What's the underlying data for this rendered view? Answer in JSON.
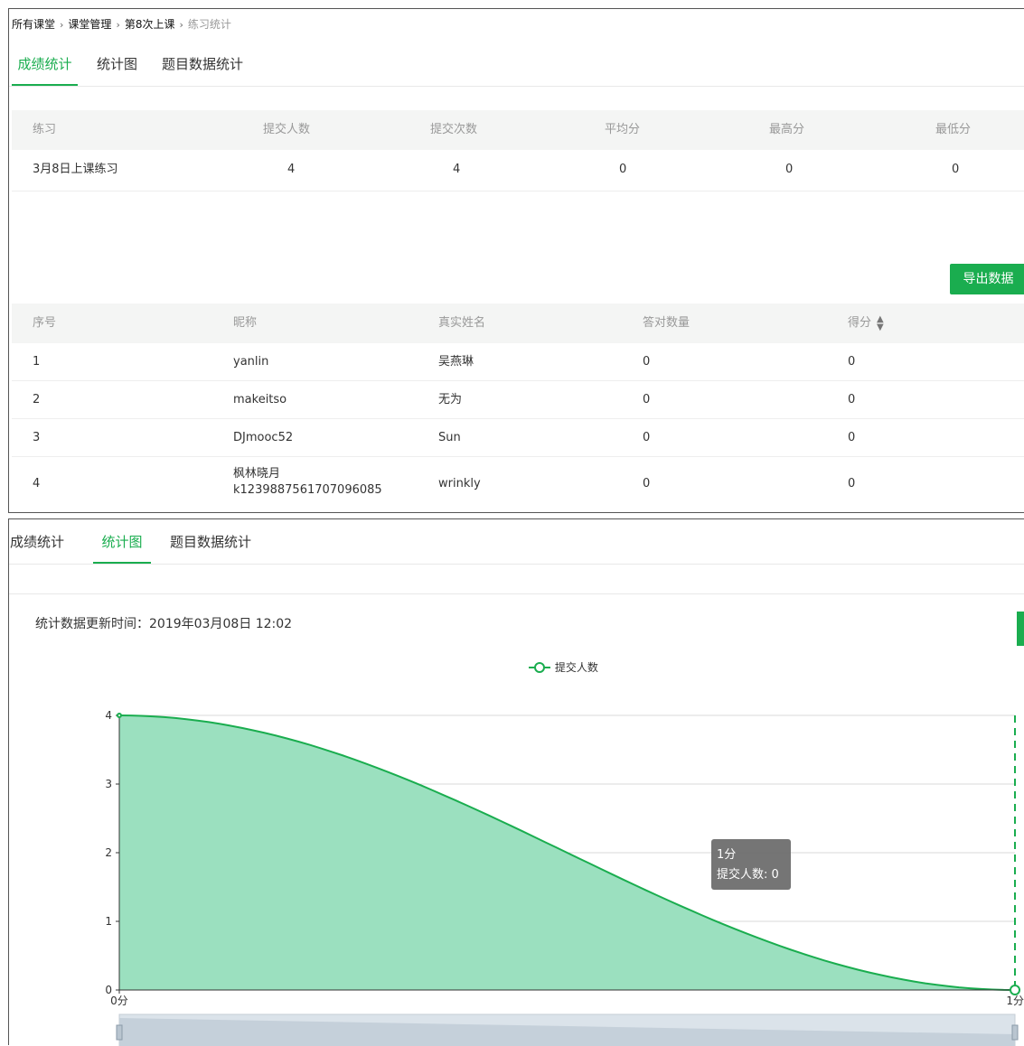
{
  "breadcrumb": {
    "items": [
      "所有课堂",
      "课堂管理",
      "第8次上课"
    ],
    "current": "练习统计",
    "separator": "›"
  },
  "tabs": [
    "成绩统计",
    "统计图",
    "题目数据统计"
  ],
  "summary_table": {
    "headers": [
      "练习",
      "提交人数",
      "提交次数",
      "平均分",
      "最高分",
      "最低分"
    ],
    "rows": [
      [
        "3月8日上课练习",
        "4",
        "4",
        "0",
        "0",
        "0"
      ]
    ]
  },
  "export_button": "导出数据",
  "students_table": {
    "headers": [
      "序号",
      "昵称",
      "真实姓名",
      "答对数量",
      "得分"
    ],
    "rows": [
      {
        "index": "1",
        "nickname": "yanlin",
        "nickname2": "",
        "real_name": "吴燕琳",
        "correct": "0",
        "score": "0"
      },
      {
        "index": "2",
        "nickname": "makeitso",
        "nickname2": "",
        "real_name": "无为",
        "correct": "0",
        "score": "0"
      },
      {
        "index": "3",
        "nickname": "DJmooc52",
        "nickname2": "",
        "real_name": "Sun",
        "correct": "0",
        "score": "0"
      },
      {
        "index": "4",
        "nickname": "枫林晓月",
        "nickname2": "k1239887561707096085",
        "real_name": "wrinkly",
        "correct": "0",
        "score": "0"
      }
    ]
  },
  "update_time": "统计数据更新时间：2019年03月08日 12:02",
  "colors": {
    "accent": "#1aad4f",
    "area_fill": "#9be0bf",
    "tooltip_bg": "#6e6e6e"
  },
  "chart_data": {
    "type": "area",
    "x": [
      "0分",
      "1分"
    ],
    "series": [
      {
        "name": "提交人数",
        "values": [
          4,
          0
        ]
      }
    ],
    "ylim": [
      0,
      4
    ],
    "yticks": [
      "0",
      "1",
      "2",
      "3",
      "4"
    ],
    "smooth": true,
    "grid": true,
    "legend": "top-center",
    "tooltip": {
      "title": "1分",
      "label": "提交人数",
      "value": "0"
    }
  }
}
